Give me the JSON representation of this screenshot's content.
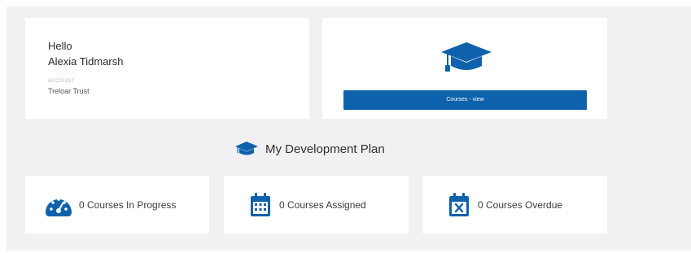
{
  "welcome": {
    "greeting": "Hello",
    "user_name": "Alexia Tidmarsh",
    "account_label": "ACCOUNT",
    "account_value": "Treloar Trust"
  },
  "courses_card": {
    "icon": "graduation-cap-icon",
    "button_label": "Courses - view"
  },
  "development_plan": {
    "icon": "graduation-cap-icon",
    "title": "My Development Plan"
  },
  "stats": [
    {
      "icon": "speedometer-icon",
      "label": "0 Courses In Progress"
    },
    {
      "icon": "calendar-icon",
      "label": "0 Courses Assigned"
    },
    {
      "icon": "calendar-x-icon",
      "label": "0 Courses Overdue"
    }
  ],
  "colors": {
    "accent": "#0e62ab",
    "background": "#f1f1f4",
    "card": "#ffffff"
  }
}
